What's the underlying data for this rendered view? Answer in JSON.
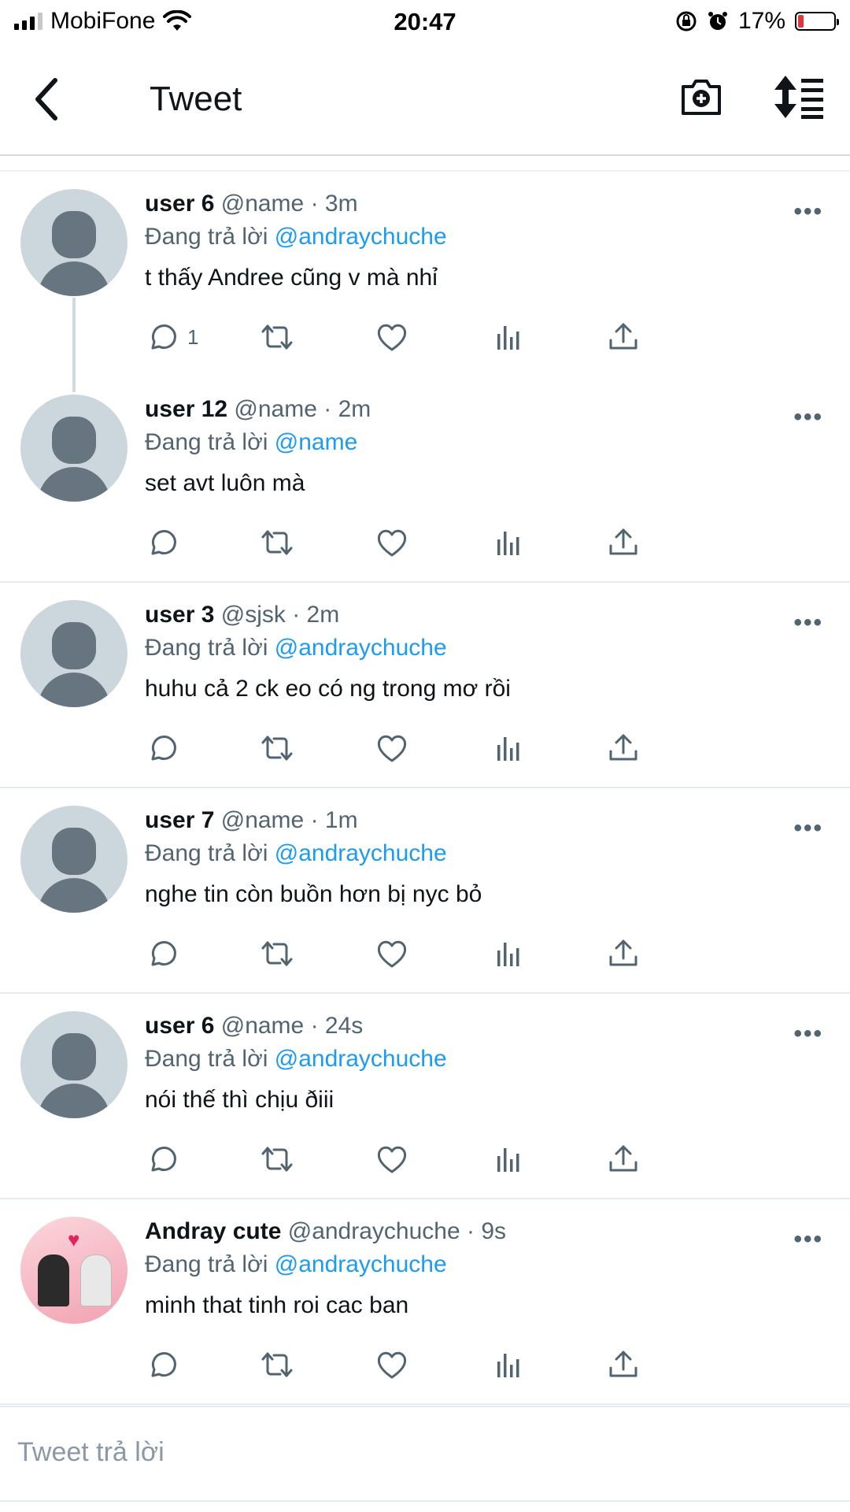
{
  "status_bar": {
    "carrier": "MobiFone",
    "time": "20:47",
    "battery": "17%",
    "battery_level": 0.17,
    "icons": [
      "signal-icon",
      "wifi-icon",
      "orientation-lock-icon",
      "alarm-icon",
      "battery-charging-icon"
    ]
  },
  "nav": {
    "title": "Tweet",
    "icons": [
      "back-chevron-icon",
      "camera-plus-icon",
      "sort-icon"
    ]
  },
  "colors": {
    "accent": "#1d9bf0",
    "text": "#0f1419",
    "secondary": "#536471",
    "avatar_bg": "#ccd6dd"
  },
  "tweets": [
    {
      "name": "user 6",
      "handle": "@name",
      "sep": " · ",
      "time": "3m",
      "reply_prefix": "Đang trả lời ",
      "reply_to": "@andraychuche",
      "text": "t thấy Andree cũng v mà nhỉ",
      "reply_count": "1",
      "more": "•••"
    },
    {
      "name": "user 12",
      "handle": "@name",
      "sep": " · ",
      "time": "2m",
      "reply_prefix": "Đang trả lời ",
      "reply_to": "@name",
      "text": "set avt luôn mà",
      "reply_count": "",
      "more": "•••"
    },
    {
      "name": "user 3",
      "handle": "@sjsk",
      "sep": " · ",
      "time": "2m",
      "reply_prefix": "Đang trả lời ",
      "reply_to": "@andraychuche",
      "text": "huhu cả 2 ck eo có ng trong mơ rồi",
      "reply_count": "",
      "more": "•••"
    },
    {
      "name": "user 7",
      "handle": "@name",
      "sep": " · ",
      "time": "1m",
      "reply_prefix": "Đang trả lời ",
      "reply_to": "@andraychuche",
      "text": "nghe tin còn buồn hơn bị nyc bỏ",
      "reply_count": "",
      "more": "•••"
    },
    {
      "name": "user 6",
      "handle": "@name",
      "sep": " · ",
      "time": "24s",
      "reply_prefix": "Đang trả lời ",
      "reply_to": "@andraychuche",
      "text": "nói thế thì chịu ðiii",
      "reply_count": "",
      "more": "•••"
    },
    {
      "name": "Andray cute",
      "handle": "@andraychuche",
      "sep": " · ",
      "time": "9s",
      "reply_prefix": "Đang trả lời ",
      "reply_to": "@andraychuche",
      "text": "minh that tinh roi cac ban",
      "reply_count": "",
      "more": "•••"
    }
  ],
  "reply_box": {
    "placeholder": "Tweet trả lời"
  }
}
